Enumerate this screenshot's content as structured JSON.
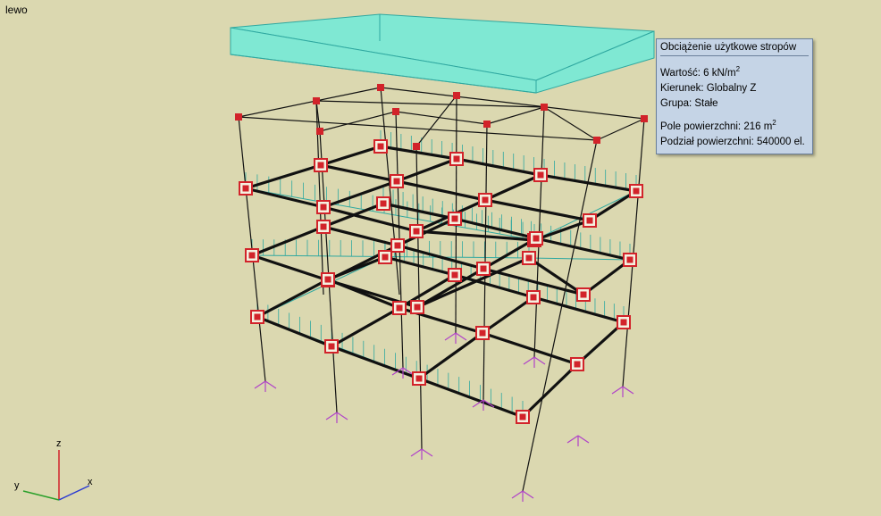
{
  "view": {
    "label": "lewo"
  },
  "tooltip": {
    "title": "Obciążenie użytkowe stropów",
    "value_label": "Wartość: 6 kN/m",
    "value_exp": "2",
    "direction": "Kierunek: Globalny Z",
    "group": "Grupa: Stałe",
    "area_label": "Pole powierzchni: 216 m",
    "area_exp": "2",
    "division": "Podział powierzchni: 540000 el."
  },
  "axes": {
    "z": "z",
    "y": "y",
    "x": "x"
  },
  "colors": {
    "background": "#dbd8b0",
    "load_fill": "#7fe8d3",
    "load_stroke": "#2fa8a0",
    "node_red": "#d2232a",
    "beam": "#111111",
    "support": "#b042c8",
    "tooltip_bg": "#c5d4e6"
  }
}
